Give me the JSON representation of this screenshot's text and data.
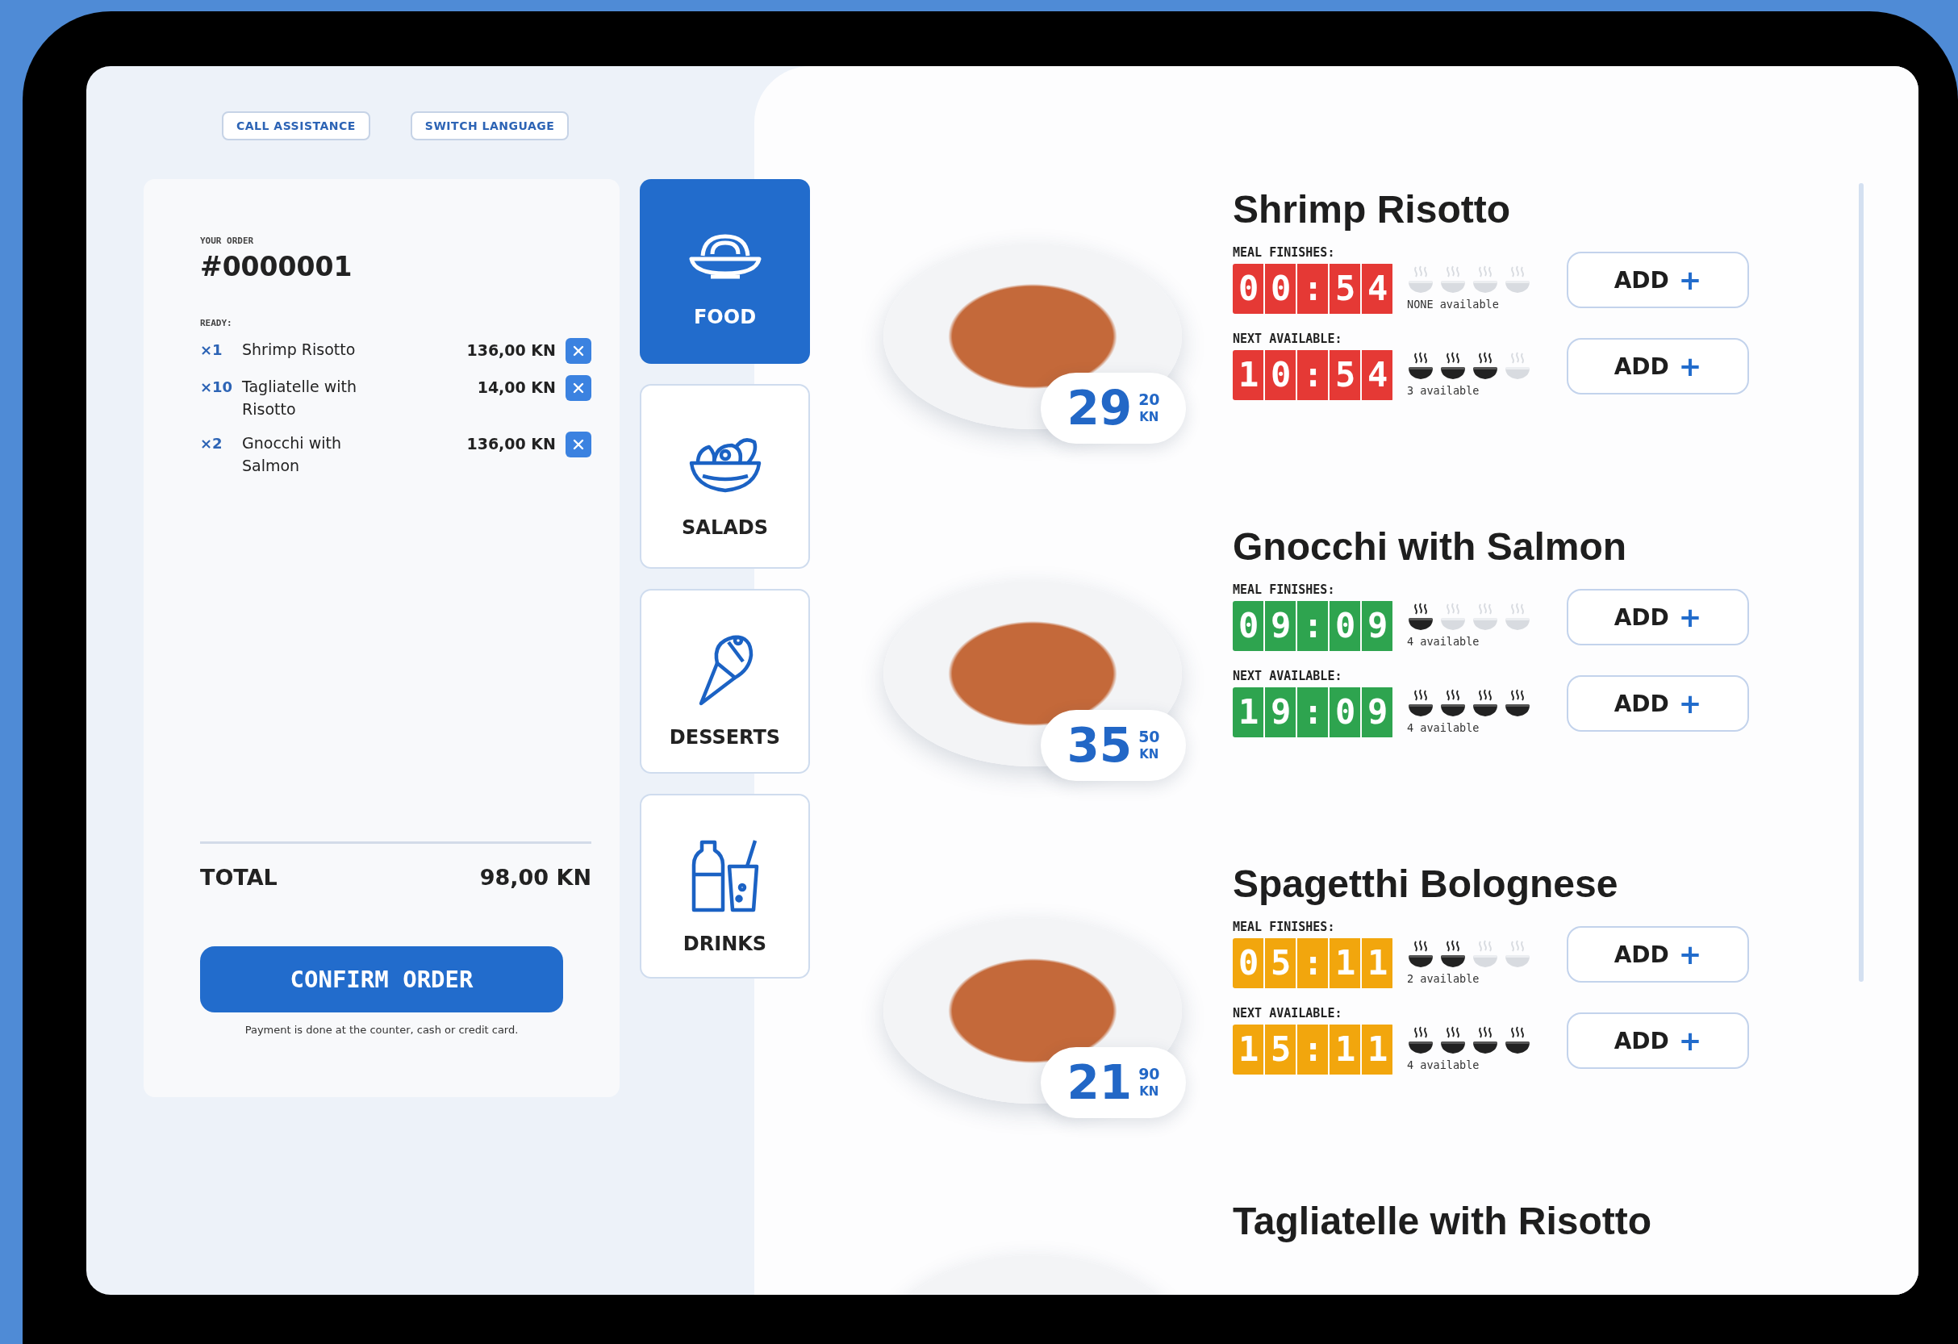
{
  "header_buttons": [
    {
      "label": "CALL ASSISTANCE"
    },
    {
      "label": "SWITCH LANGUAGE"
    }
  ],
  "order": {
    "label": "YOUR ORDER",
    "number": "#0000001",
    "section_label": "READY:",
    "items": [
      {
        "qty": "×1",
        "name": "Shrimp Risotto",
        "price": "136,00 KN"
      },
      {
        "qty": "×10",
        "name": "Tagliatelle with Risotto",
        "price": "14,00 KN"
      },
      {
        "qty": "×2",
        "name": "Gnocchi with Salmon",
        "price": "136,00 KN"
      }
    ],
    "total_label": "TOTAL",
    "total": "98,00 KN",
    "confirm": "CONFIRM ORDER",
    "note": "Payment is done at the counter, cash or credit card."
  },
  "categories": [
    {
      "kind": "food",
      "label": "FOOD",
      "selected": true
    },
    {
      "kind": "salads",
      "label": "SALADS",
      "selected": false
    },
    {
      "kind": "desserts",
      "label": "DESSERTS",
      "selected": false
    },
    {
      "kind": "drinks",
      "label": "DRINKS",
      "selected": false
    }
  ],
  "dishes": [
    {
      "name": "Shrimp Risotto",
      "price_main": "29",
      "price_cents": "20",
      "currency": "KN",
      "slots": [
        {
          "label": "MEAL FINISHES:",
          "time": "00:54",
          "color": "#e53935",
          "bowls": [
            {
              "filled": false
            },
            {
              "filled": false
            },
            {
              "filled": false
            },
            {
              "filled": false
            }
          ],
          "availability": "NONE available",
          "button": "ADD",
          "plus": "+"
        },
        {
          "label": "NEXT AVAILABLE:",
          "time": "10:54",
          "color": "#e53935",
          "bowls": [
            {
              "filled": true
            },
            {
              "filled": true
            },
            {
              "filled": true
            },
            {
              "filled": false
            }
          ],
          "availability": "3 available",
          "button": "ADD",
          "plus": "+"
        }
      ]
    },
    {
      "name": "Gnocchi with Salmon",
      "price_main": "35",
      "price_cents": "50",
      "currency": "KN",
      "slots": [
        {
          "label": "MEAL FINISHES:",
          "time": "09:09",
          "color": "#2ea44f",
          "bowls": [
            {
              "filled": true
            },
            {
              "filled": false
            },
            {
              "filled": false
            },
            {
              "filled": false
            }
          ],
          "availability": "4 available",
          "button": "ADD",
          "plus": "+"
        },
        {
          "label": "NEXT AVAILABLE:",
          "time": "19:09",
          "color": "#2ea44f",
          "bowls": [
            {
              "filled": true
            },
            {
              "filled": true
            },
            {
              "filled": true
            },
            {
              "filled": true
            }
          ],
          "availability": "4 available",
          "button": "ADD",
          "plus": "+"
        }
      ]
    },
    {
      "name": "Spagetthi Bolognese",
      "price_main": "21",
      "price_cents": "90",
      "currency": "KN",
      "slots": [
        {
          "label": "MEAL FINISHES:",
          "time": "05:11",
          "color": "#f2a60d",
          "bowls": [
            {
              "filled": true
            },
            {
              "filled": true
            },
            {
              "filled": false
            },
            {
              "filled": false
            }
          ],
          "availability": "2 available",
          "button": "ADD",
          "plus": "+"
        },
        {
          "label": "NEXT AVAILABLE:",
          "time": "15:11",
          "color": "#f2a60d",
          "bowls": [
            {
              "filled": true
            },
            {
              "filled": true
            },
            {
              "filled": true
            },
            {
              "filled": true
            }
          ],
          "availability": "4 available",
          "button": "ADD",
          "plus": "+"
        }
      ]
    },
    {
      "name": "Tagliatelle with Risotto"
    }
  ]
}
